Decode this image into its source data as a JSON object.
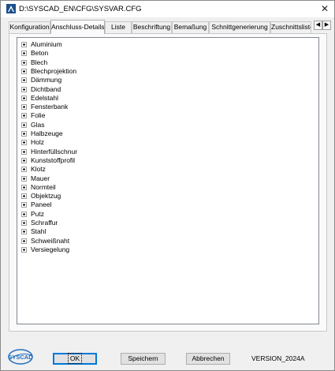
{
  "window": {
    "title": "D:\\SYSCAD_EN\\CFG\\SYSVAR.CFG",
    "close_glyph": "✕"
  },
  "tabs": [
    {
      "label": "Konfiguration",
      "active": false
    },
    {
      "label": "Anschluss-Details",
      "active": true
    },
    {
      "label": "Liste",
      "active": false
    },
    {
      "label": "Beschriftung",
      "active": false
    },
    {
      "label": "Bemaßung",
      "active": false
    },
    {
      "label": "Schnittgenerierung",
      "active": false
    },
    {
      "label": "Zuschnittsliste",
      "active": false
    }
  ],
  "tab_scroll": {
    "left": "◀",
    "right": "▶"
  },
  "tree_items": [
    "Aluminium",
    "Beton",
    "Blech",
    "Blechprojektion",
    "Dämmung",
    "Dichtband",
    "Edelstahl",
    "Fensterbank",
    "Folie",
    "Glas",
    "Halbzeuge",
    "Holz",
    "Hinterfüllschnur",
    "Kunststoffprofil",
    "Klotz",
    "Mauer",
    "Normteil",
    "Objektzug",
    "Paneel",
    "Putz",
    "Schraffur",
    "Stahl",
    "Schweißnaht",
    "Versiegelung"
  ],
  "logo": {
    "text": "SYSCAD",
    "color": "#1f6fc0"
  },
  "buttons": {
    "ok": "OK",
    "save": "Speichern",
    "cancel": "Abbrechen"
  },
  "version": "VERSION_2024A",
  "colors": {
    "accent": "#0078d7",
    "tree_border": "#828790"
  }
}
